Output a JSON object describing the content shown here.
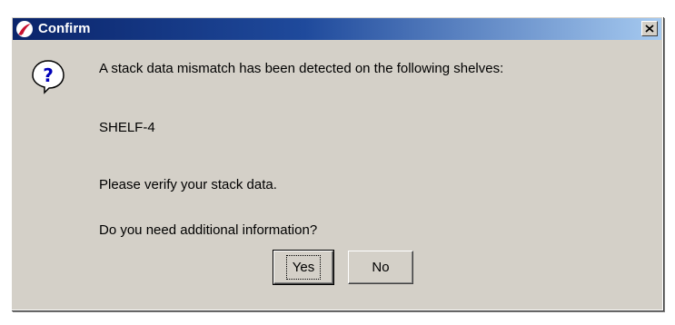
{
  "window": {
    "title": "Confirm"
  },
  "icons": {
    "app": "red-swoosh-app-icon",
    "close": "close-x-icon",
    "message": "question-mark-icon"
  },
  "message": {
    "line1": "A stack data mismatch has been detected on the following shelves:",
    "line2": "SHELF-4",
    "line3": "Please verify your stack data.",
    "line4": "Do you need additional information?"
  },
  "buttons": {
    "yes": "Yes",
    "no": "No"
  },
  "colors": {
    "titlebar_start": "#0a246a",
    "titlebar_end": "#a6caf0",
    "dialog_bg": "#d4d0c8",
    "question_bubble": "#ffffff",
    "question_mark": "#0000b8"
  }
}
